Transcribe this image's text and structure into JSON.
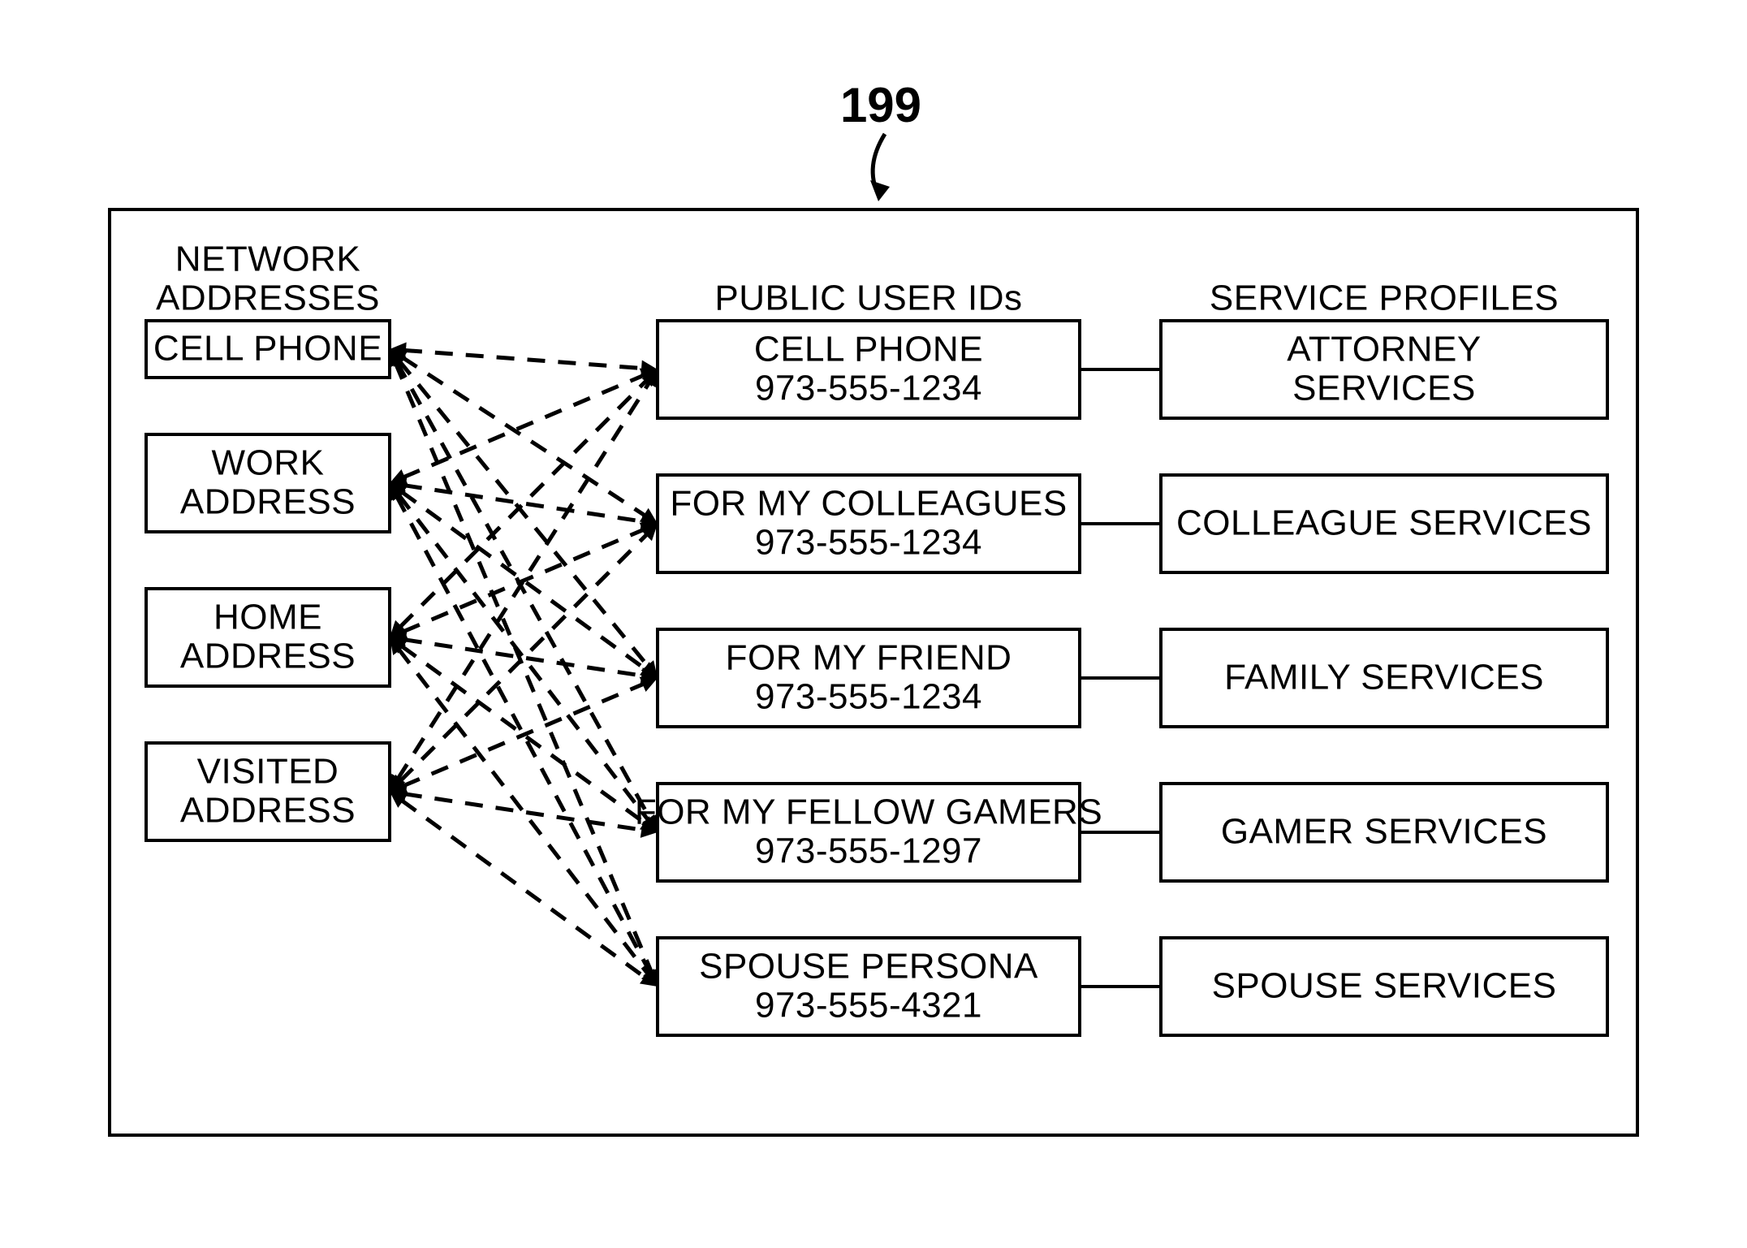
{
  "refnum": "199",
  "columns": {
    "network": {
      "heading1": "NETWORK",
      "heading2": "ADDRESSES",
      "items": [
        {
          "l1": "CELL PHONE"
        },
        {
          "l1": "WORK",
          "l2": "ADDRESS"
        },
        {
          "l1": "HOME",
          "l2": "ADDRESS"
        },
        {
          "l1": "VISITED",
          "l2": "ADDRESS"
        }
      ]
    },
    "public": {
      "heading": "PUBLIC USER IDs",
      "items": [
        {
          "l1": "CELL PHONE",
          "l2": "973-555-1234"
        },
        {
          "l1": "FOR MY COLLEAGUES",
          "l2": "973-555-1234"
        },
        {
          "l1": "FOR MY FRIEND",
          "l2": "973-555-1234"
        },
        {
          "l1": "FOR MY FELLOW GAMERS",
          "l2": "973-555-1297"
        },
        {
          "l1": "SPOUSE PERSONA",
          "l2": "973-555-4321"
        }
      ]
    },
    "service": {
      "heading": "SERVICE PROFILES",
      "items": [
        {
          "l1": "ATTORNEY",
          "l2": "SERVICES"
        },
        {
          "l1": "COLLEAGUE SERVICES"
        },
        {
          "l1": "FAMILY SERVICES"
        },
        {
          "l1": "GAMER SERVICES"
        },
        {
          "l1": "SPOUSE SERVICES"
        }
      ]
    }
  }
}
